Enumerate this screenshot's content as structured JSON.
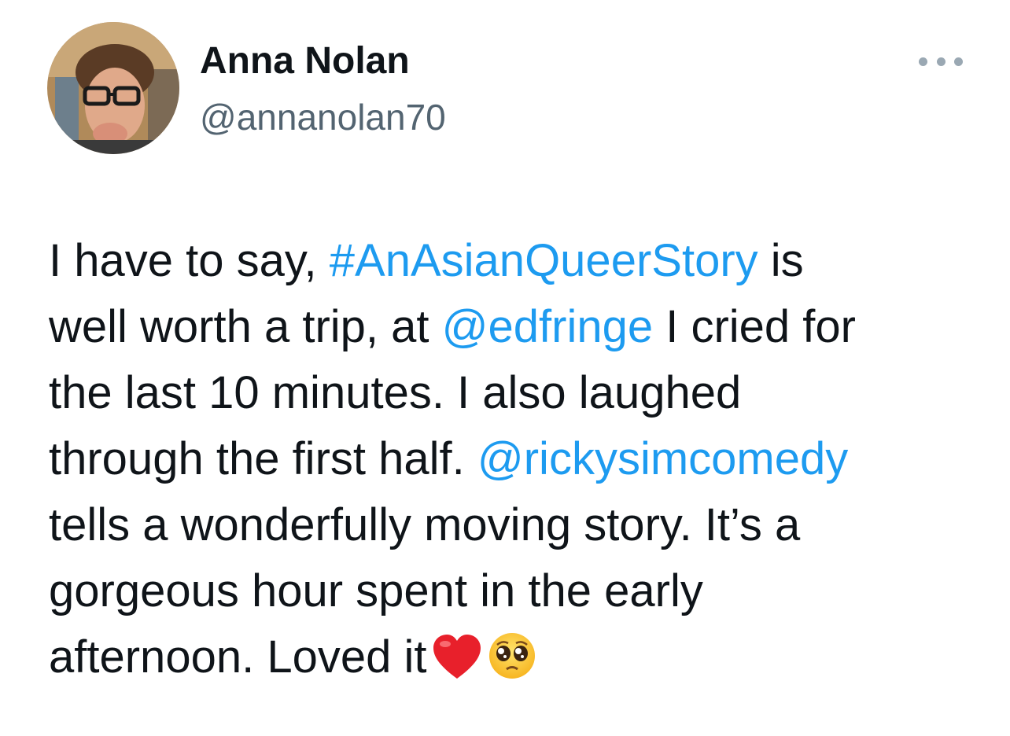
{
  "author": {
    "name": "Anna Nolan",
    "handle": "@annanolan70"
  },
  "more_menu": {
    "icon": "more-horizontal-icon"
  },
  "tweet": {
    "lines": [
      {
        "t1": "I have to say, ",
        "link": "#AnAsianQueerStory",
        "t2": " is"
      },
      {
        "t1": "well worth a trip, at ",
        "link": "@edfringe",
        "t2": " I cried for"
      },
      {
        "t1": "the last 10 minutes. I also laughed"
      },
      {
        "t1": "through the first half. ",
        "link": "@rickysimcomedy"
      },
      {
        "t1": "tells a wonderfully moving story. It’s a"
      },
      {
        "t1": "gorgeous hour spent in the early"
      },
      {
        "t1": "afternoon. Loved it"
      }
    ],
    "emojis": [
      "red-heart-emoji",
      "pleading-face-emoji"
    ]
  },
  "colors": {
    "text": "#0f1419",
    "secondary": "#536471",
    "link": "#1d9bf0",
    "background": "#ffffff"
  }
}
